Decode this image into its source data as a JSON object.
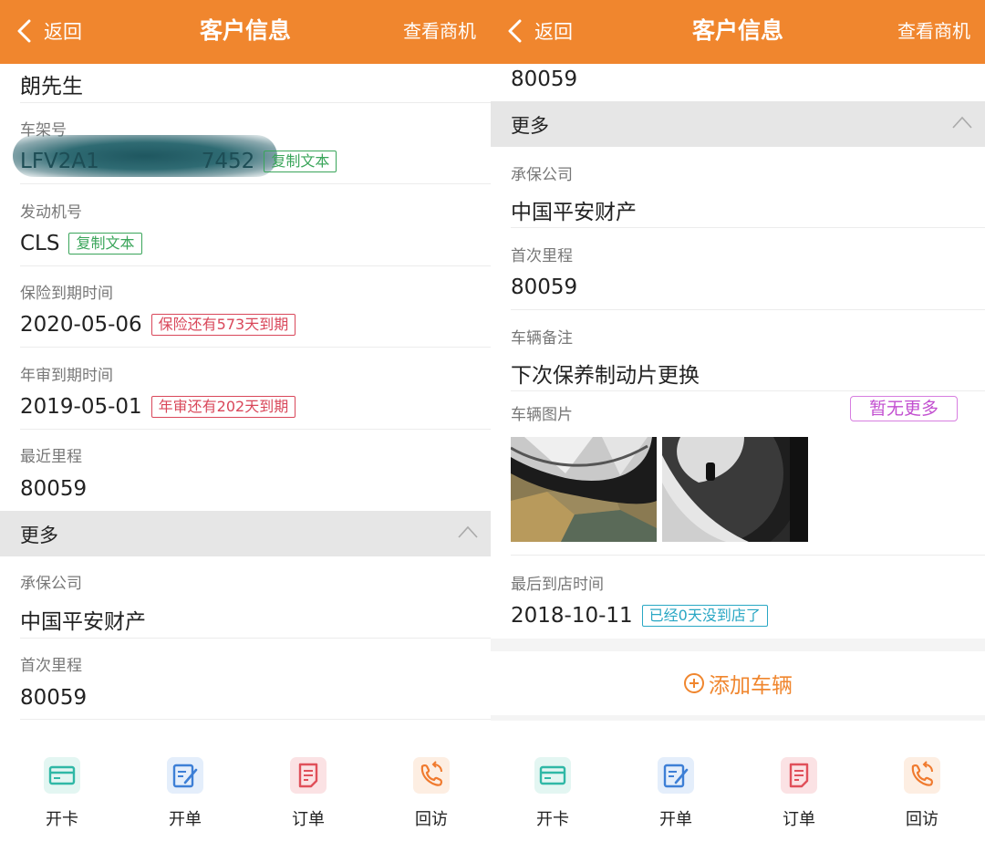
{
  "header": {
    "back_label": "返回",
    "title": "客户信息",
    "right_action": "查看商机"
  },
  "left": {
    "customer_name": "朗先生",
    "vin_label": "车架号",
    "vin_value": "LFV2A1",
    "vin_suffix": "7452",
    "copy_text": "复制文本",
    "engine_label": "发动机号",
    "engine_value": "CLS",
    "insurance_label": "保险到期时间",
    "insurance_value": "2020-05-06",
    "insurance_badge": "保险还有573天到期",
    "inspection_label": "年审到期时间",
    "inspection_value": "2019-05-01",
    "inspection_badge": "年审还有202天到期",
    "recent_mileage_label": "最近里程",
    "recent_mileage_value": "80059",
    "more_label": "更多",
    "insurer_label": "承保公司",
    "insurer_value": "中国平安财产",
    "first_mileage_label": "首次里程",
    "first_mileage_value": "80059"
  },
  "right": {
    "recent_mileage_value": "80059",
    "more_label": "更多",
    "insurer_label": "承保公司",
    "insurer_value": "中国平安财产",
    "first_mileage_label": "首次里程",
    "first_mileage_value": "80059",
    "remark_label": "车辆备注",
    "remark_value": "下次保养制动片更换",
    "photos_label": "车辆图片",
    "no_more_badge": "暂无更多",
    "last_visit_label": "最后到店时间",
    "last_visit_value": "2018-10-11",
    "last_visit_badge": "已经0天没到店了",
    "add_vehicle": "添加车辆"
  },
  "tabs": [
    {
      "label": "开卡",
      "icon": "card-icon",
      "color": "#2fb8a6",
      "bg": "#e3f6f2"
    },
    {
      "label": "开单",
      "icon": "edit-form-icon",
      "color": "#3d7fd6",
      "bg": "#e4eefb"
    },
    {
      "label": "订单",
      "icon": "order-icon",
      "color": "#e0505a",
      "bg": "#fbe2e4"
    },
    {
      "label": "回访",
      "icon": "callback-phone-icon",
      "color": "#f07a2e",
      "bg": "#fdeee2"
    }
  ],
  "colors": {
    "accent": "#f0862e",
    "section_bg": "#e6e6e6"
  }
}
